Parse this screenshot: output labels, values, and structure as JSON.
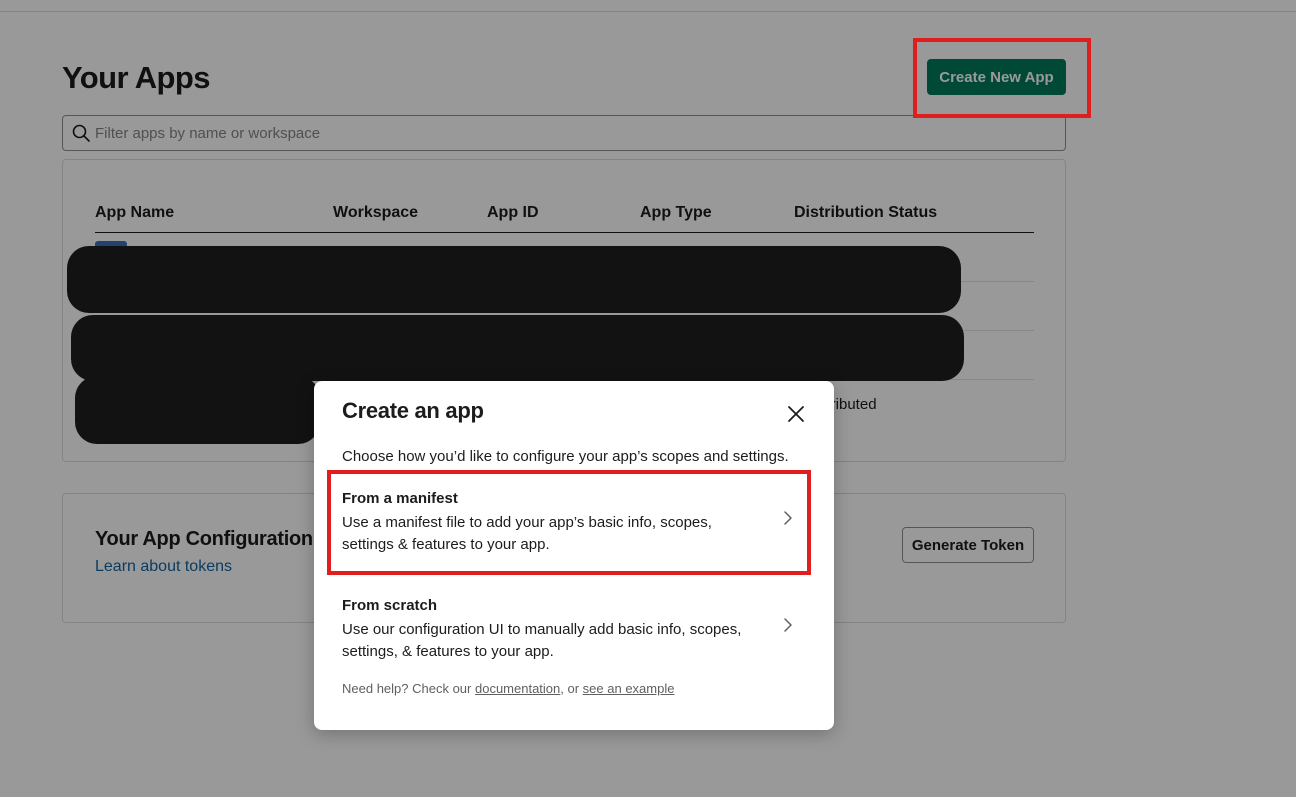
{
  "header": {
    "title": "Your Apps",
    "create_button_label": "Create New App"
  },
  "search": {
    "placeholder": "Filter apps by name or workspace",
    "value": ""
  },
  "apps_table": {
    "columns": [
      "App Name",
      "Workspace",
      "App ID",
      "App Type",
      "Distribution Status"
    ],
    "visible_cell_fragment": "stributed"
  },
  "token_section": {
    "title": "Your App Configuration T",
    "link_label": "Learn about tokens",
    "generate_button_label": "Generate Token"
  },
  "modal": {
    "title": "Create an app",
    "subtitle": "Choose how you’d like to configure your app’s scopes and settings.",
    "options": [
      {
        "title": "From a manifest",
        "description": "Use a manifest file to add your app’s basic info, scopes, settings & features to your app."
      },
      {
        "title": "From scratch",
        "description": "Use our configuration UI to manually add basic info, scopes, settings, & features to your app."
      }
    ],
    "help_prefix": "Need help? Check our ",
    "help_link_docs": "documentation",
    "help_separator": ", or ",
    "help_link_example": "see an example"
  },
  "colors": {
    "primary_button": "#007a5a",
    "highlight": "#e01e1e",
    "link": "#1264a3",
    "redaction": "#1f1f1f"
  },
  "icons": {
    "search": "search-icon",
    "close": "close-icon",
    "chevron": "chevron-right-icon"
  }
}
